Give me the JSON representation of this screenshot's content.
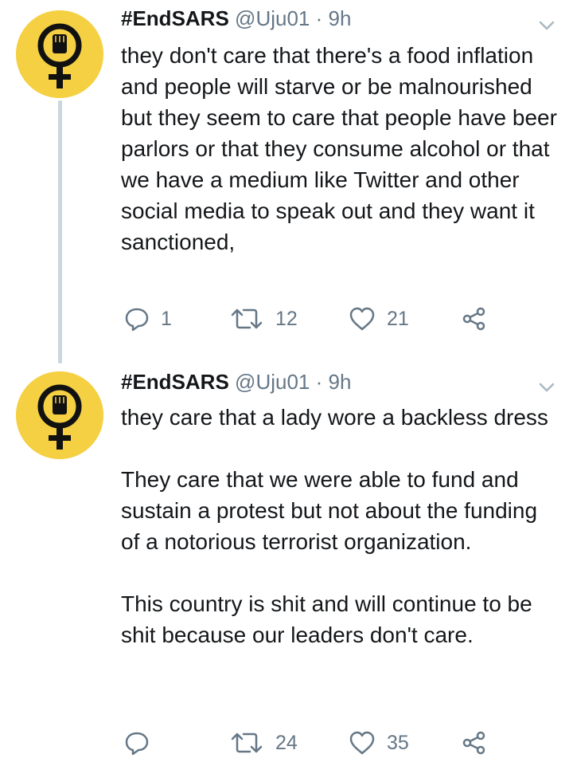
{
  "tweets": [
    {
      "display_name": "#EndSARS",
      "handle": "@Uju01",
      "separator": "·",
      "time": "9h",
      "paragraphs": [
        "they don't care that there's a food inflation and people will starve or be malnourished but they seem to care that people have beer parlors or that they consume alcohol or that we have a medium like Twitter and other social media to speak out and they want it sanctioned,"
      ],
      "replies": "1",
      "retweets": "12",
      "likes": "21"
    },
    {
      "display_name": "#EndSARS",
      "handle": "@Uju01",
      "separator": "·",
      "time": "9h",
      "paragraphs": [
        "they care that a lady wore a backless dress",
        "They care that we were able to fund and sustain a protest but not about the funding of a notorious terrorist organization.",
        "This country is shit and will continue to be shit because our leaders don't care."
      ],
      "replies": "",
      "retweets": "24",
      "likes": "35"
    }
  ],
  "icons": {
    "avatar": "feminist-fist-symbol-icon",
    "menu": "chevron-down-icon",
    "reply": "reply-icon",
    "retweet": "retweet-icon",
    "like": "heart-icon",
    "share": "share-icon"
  },
  "colors": {
    "avatar_bg": "#f5d042",
    "secondary_text": "#657786",
    "thread_line": "#ccd6dd"
  }
}
